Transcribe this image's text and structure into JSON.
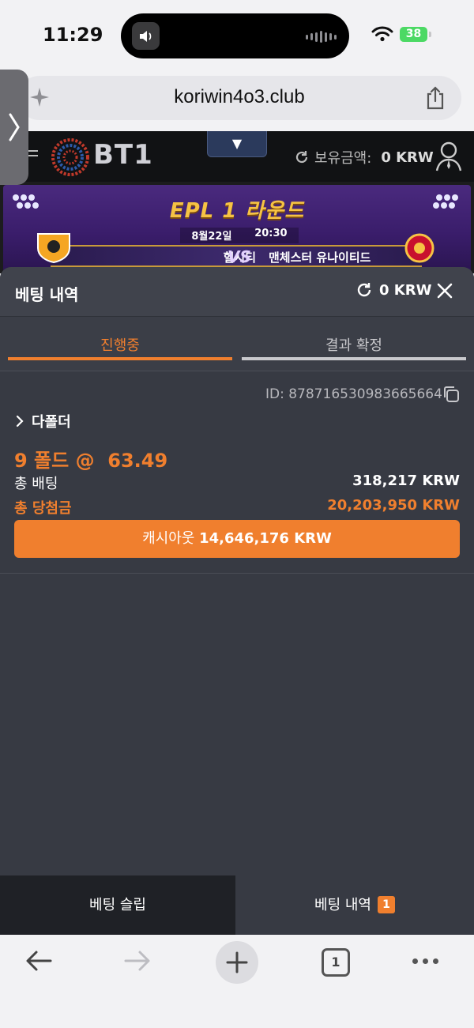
{
  "status_bar": {
    "time": "11:29",
    "battery": "38"
  },
  "browser": {
    "url": "koriwin4o3.club",
    "tab_count": "1"
  },
  "site_header": {
    "logo_text": "BT1",
    "dropdown_symbol": "▼",
    "balance_label": "보유금액:",
    "balance_value": "0 KRW"
  },
  "banner": {
    "title": "EPL 1 라운드",
    "date": "8월22일",
    "time": "20:30",
    "home_team": "헐시티",
    "vs": "VS",
    "away_team": "맨체스터 유나이티드"
  },
  "panel": {
    "title": "베팅 내역",
    "balance": "0 KRW",
    "tabs": [
      {
        "label": "진행중",
        "active": true
      },
      {
        "label": "결과 확정",
        "active": false
      }
    ],
    "bet": {
      "id": "ID: 878716530983665664",
      "type": "다폴더",
      "odds": "9 폴드 @  63.49",
      "stake_label": "총 배팅",
      "stake_value": "318,217 KRW",
      "win_label": "총 당첨금",
      "win_value": "20,203,950 KRW",
      "cashout_label": "캐시아웃",
      "cashout_value": "14,646,176 KRW"
    }
  },
  "bottom_tabs": {
    "bet_slip": "베팅 슬립",
    "bet_history": "베팅 내역",
    "bet_history_count": "1"
  },
  "colors": {
    "accent": "#f07f2e",
    "panel": "#373a43",
    "header": "#111214"
  },
  "icons": [
    "speaker-icon",
    "wifi-icon",
    "sparkle-icon",
    "share-icon",
    "chevron-right-icon",
    "refresh-icon",
    "user-icon",
    "close-icon",
    "copy-icon",
    "back-arrow-icon",
    "forward-arrow-icon",
    "plus-icon",
    "more-icon"
  ]
}
